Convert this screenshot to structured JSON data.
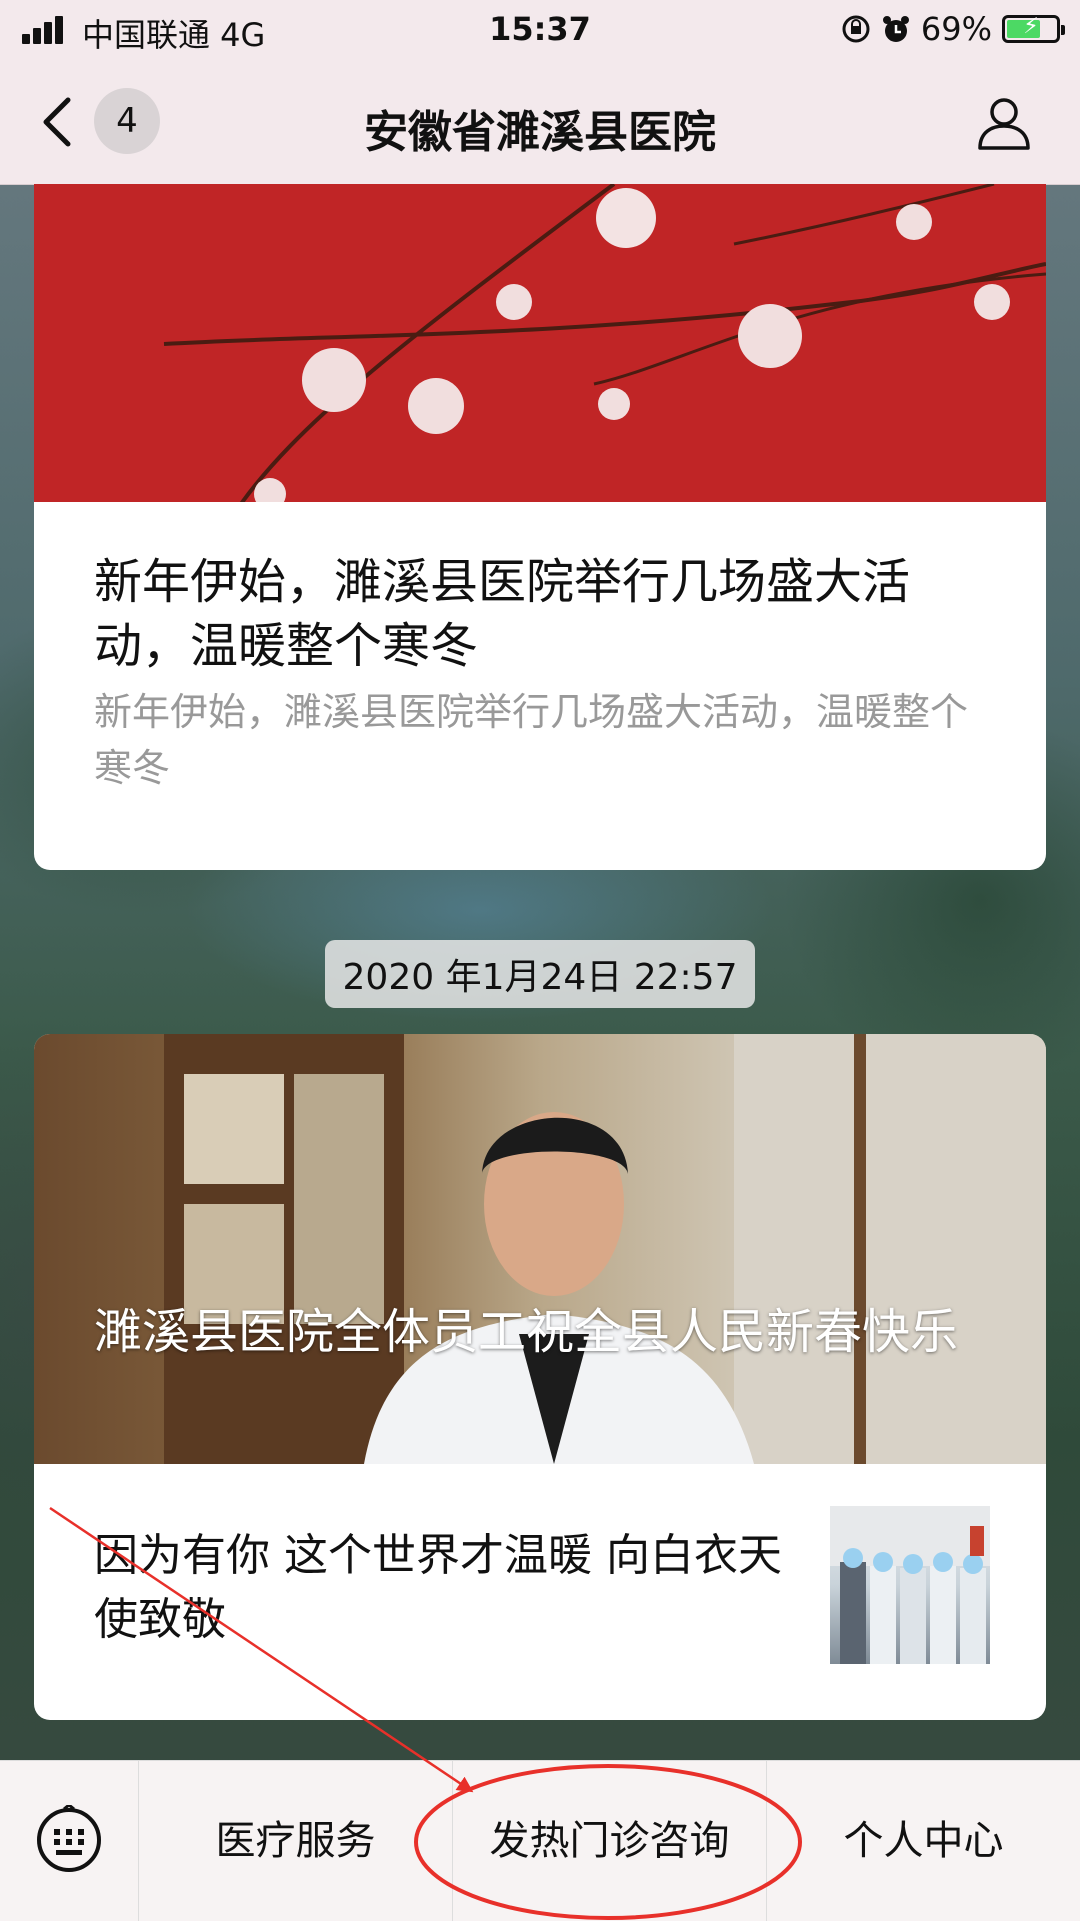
{
  "status_bar": {
    "carrier": "中国联通  4G",
    "time": "15:37",
    "battery": "69%",
    "battery_level": 0.69
  },
  "nav": {
    "badge": "4",
    "title": "安徽省濉溪县医院"
  },
  "articles": [
    {
      "title": "新年伊始，濉溪县医院举行几场盛大活动，温暖整个寒冬",
      "summary": "新年伊始，濉溪县医院举行几场盛大活动，温暖整个寒冬"
    }
  ],
  "timestamp": "2020 年1月24日 22:57",
  "news_group": {
    "headline": "濉溪县医院全体员工祝全县人民新春快乐",
    "item": "因为有你 这个世界才温暖 向白衣天使致敬"
  },
  "tab_bar": {
    "items": [
      "医疗服务",
      "发热门诊咨询",
      "个人中心"
    ]
  },
  "annotation": {
    "color": "#e8302a"
  }
}
